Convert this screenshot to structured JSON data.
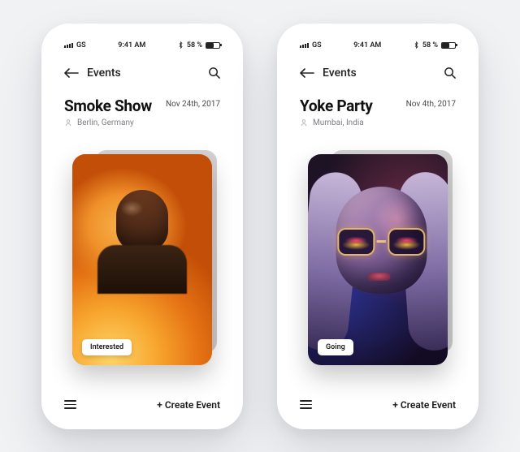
{
  "statusbar": {
    "carrier": "GS",
    "time": "9:41 AM",
    "battery_text": "58 %"
  },
  "nav": {
    "title": "Events"
  },
  "bottom": {
    "create_label": "+ Create Event"
  },
  "phones": [
    {
      "event": {
        "title": "Smoke Show",
        "date": "Nov 24th, 2017",
        "location": "Berlin, Germany",
        "action_label": "Interested"
      }
    },
    {
      "event": {
        "title": "Yoke Party",
        "date": "Nov 4th, 2017",
        "location": "Mumbai, India",
        "action_label": "Going"
      }
    }
  ]
}
